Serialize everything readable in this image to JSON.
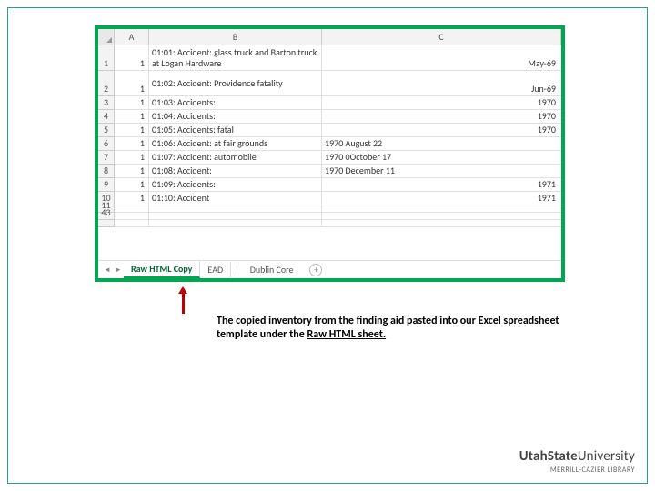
{
  "columns": {
    "a": "A",
    "b": "B",
    "c": "C"
  },
  "rows": [
    {
      "n": "1",
      "a": "1",
      "b": "01:01: Accident: glass truck and Barton truck at Logan Hardware",
      "cL": "",
      "cR": "May-69"
    },
    {
      "n": "2",
      "a": "1",
      "b": "01:02: Accident: Providence fatality",
      "cL": "",
      "cR": "Jun-69"
    },
    {
      "n": "3",
      "a": "1",
      "b": "01:03: Accidents:",
      "cL": "",
      "cR": "1970"
    },
    {
      "n": "4",
      "a": "1",
      "b": "01:04: Accidents:",
      "cL": "",
      "cR": "1970"
    },
    {
      "n": "5",
      "a": "1",
      "b": "01:05: Accidents: fatal",
      "cL": "",
      "cR": "1970"
    },
    {
      "n": "6",
      "a": "1",
      "b": "01:06: Accident: at fair grounds",
      "cL": "1970 August 22",
      "cR": ""
    },
    {
      "n": "7",
      "a": "1",
      "b": "01:07: Accident: automobile",
      "cL": "1970 0October 17",
      "cR": ""
    },
    {
      "n": "8",
      "a": "1",
      "b": "01:08: Accident:",
      "cL": "1970 December 11",
      "cR": ""
    },
    {
      "n": "9",
      "a": "1",
      "b": "01:09: Accidents:",
      "cL": "",
      "cR": "1971"
    },
    {
      "n": "10",
      "a": "1",
      "b": "01:10: Accident",
      "cL": "",
      "cR": "1971"
    }
  ],
  "extraRows": [
    "11",
    "43"
  ],
  "tabs": {
    "active": "Raw HTML Copy",
    "other1": "EAD",
    "other2": "Dublin Core"
  },
  "caption": {
    "l1": "The copied inventory from the finding aid pasted into our Excel spreadsheet",
    "l2a": "template under the ",
    "l2u": "Raw HTML sheet."
  },
  "brand": {
    "top_bold": "UtahState",
    "top_rest": "University",
    "sub": "MERRILL-CAZIER LIBRARY"
  }
}
